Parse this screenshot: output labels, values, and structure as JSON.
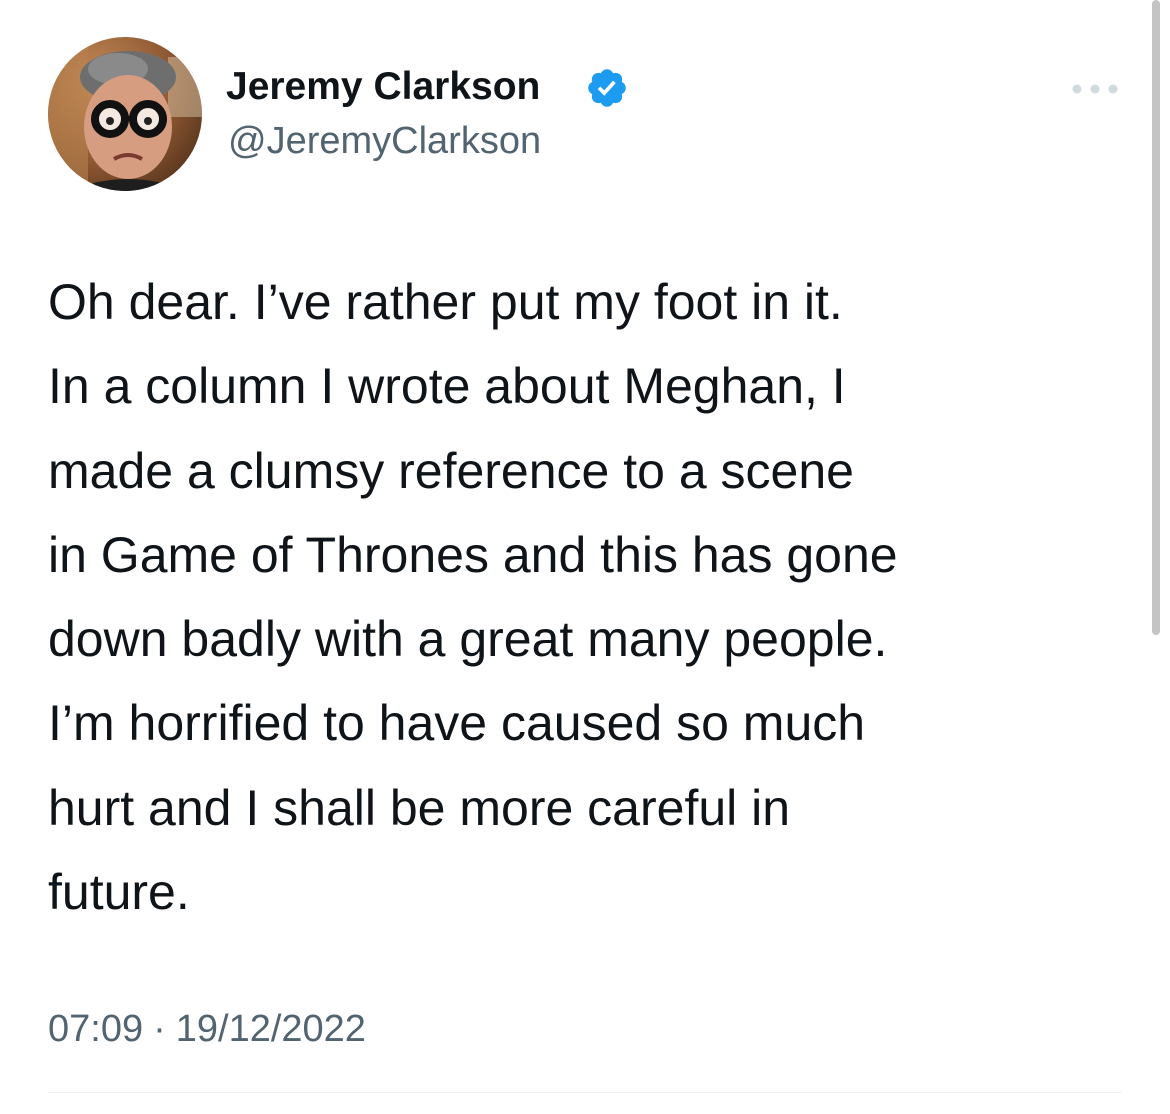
{
  "author": {
    "display_name": "Jeremy Clarkson",
    "handle": "@JeremyClarkson",
    "verified": true,
    "verified_color": "#1d9bf0"
  },
  "tweet": {
    "lines": [
      "Oh dear. I’ve rather put my foot in it.",
      "In a column I wrote about Meghan, I",
      "made a clumsy reference to a scene",
      "in Game of Thrones and this has gone",
      "down badly with a great many people.",
      "I’m horrified to have caused so much",
      "hurt and I shall be more careful in",
      "future."
    ],
    "time": "07:09",
    "separator": "·",
    "date": "19/12/2022"
  },
  "icons": {
    "more": "more-horizontal-icon",
    "verified": "verified-badge-icon"
  },
  "colors": {
    "text_primary": "#0f1419",
    "text_secondary": "#536471",
    "divider": "#eff3f4"
  }
}
